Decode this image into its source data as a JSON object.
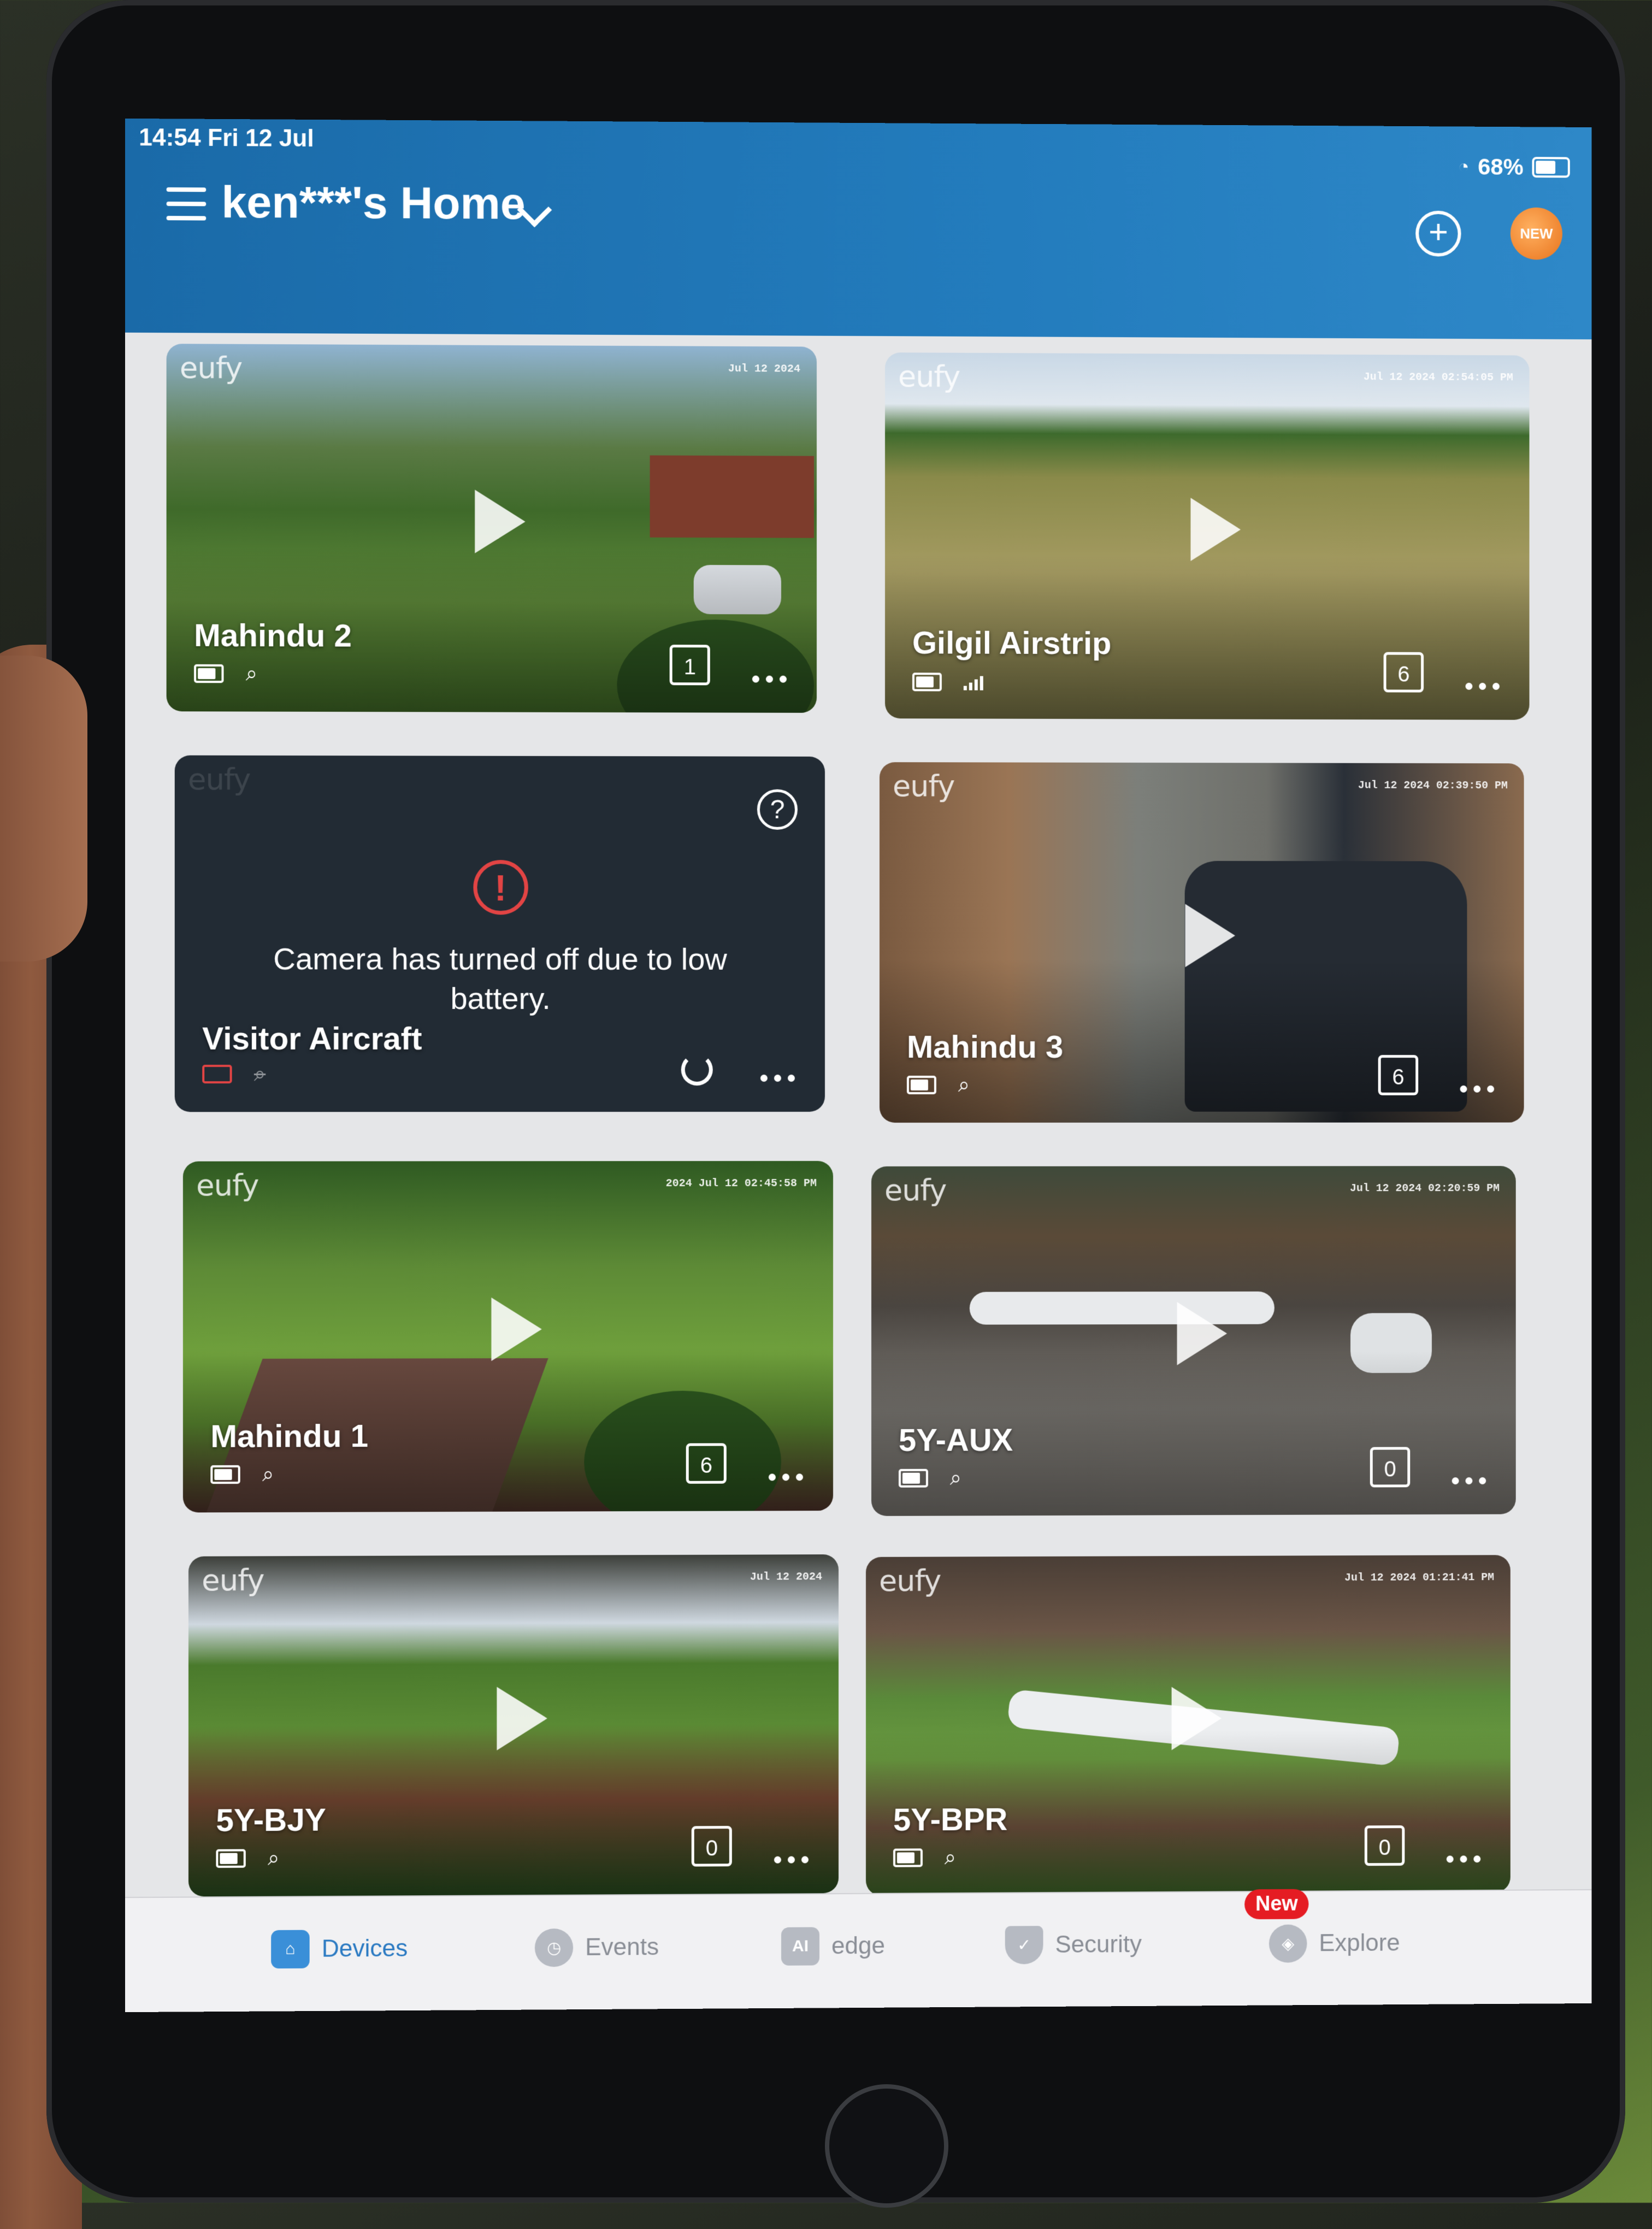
{
  "status": {
    "time": "14:54  Fri 12 Jul",
    "battery": "68%"
  },
  "header": {
    "title": "ken***'s Home"
  },
  "cameras": [
    {
      "name": "Mahindu 2",
      "events": "1",
      "timestamp": "Jul 12 2024",
      "logo": "eufy"
    },
    {
      "name": "Gilgil Airstrip",
      "events": "6",
      "timestamp": "Jul 12 2024  02:54:05 PM",
      "logo": "eufy"
    },
    {
      "name": "Visitor Aircraft",
      "message": "Camera has turned off due to low battery.",
      "logo": "eufy",
      "help": "?"
    },
    {
      "name": "Mahindu 3",
      "events": "6",
      "timestamp": "Jul 12 2024  02:39:50 PM",
      "logo": "eufy"
    },
    {
      "name": "Mahindu 1",
      "events": "6",
      "timestamp": "2024 Jul 12  02:45:58 PM",
      "logo": "eufy"
    },
    {
      "name": "5Y-AUX",
      "events": "0",
      "timestamp": "Jul 12 2024  02:20:59 PM",
      "logo": "eufy"
    },
    {
      "name": "5Y-BJY",
      "events": "0",
      "timestamp": "Jul 12 2024",
      "logo": "eufy"
    },
    {
      "name": "5Y-BPR",
      "events": "0",
      "timestamp": "Jul 12 2024  01:21:41 PM",
      "logo": "eufy"
    }
  ],
  "tabs": [
    {
      "label": "Devices",
      "icon": "house-icon"
    },
    {
      "label": "Events",
      "icon": "clock-icon"
    },
    {
      "label": "edge",
      "icon": "ai-icon",
      "glyph": "AI"
    },
    {
      "label": "Security",
      "icon": "shield-icon"
    },
    {
      "label": "Explore",
      "icon": "compass-icon",
      "badge": "New"
    }
  ],
  "colors": {
    "header": "#237cbd",
    "active_tab": "#2b7ac2",
    "alert": "#e24444",
    "badge": "#e51c23"
  }
}
